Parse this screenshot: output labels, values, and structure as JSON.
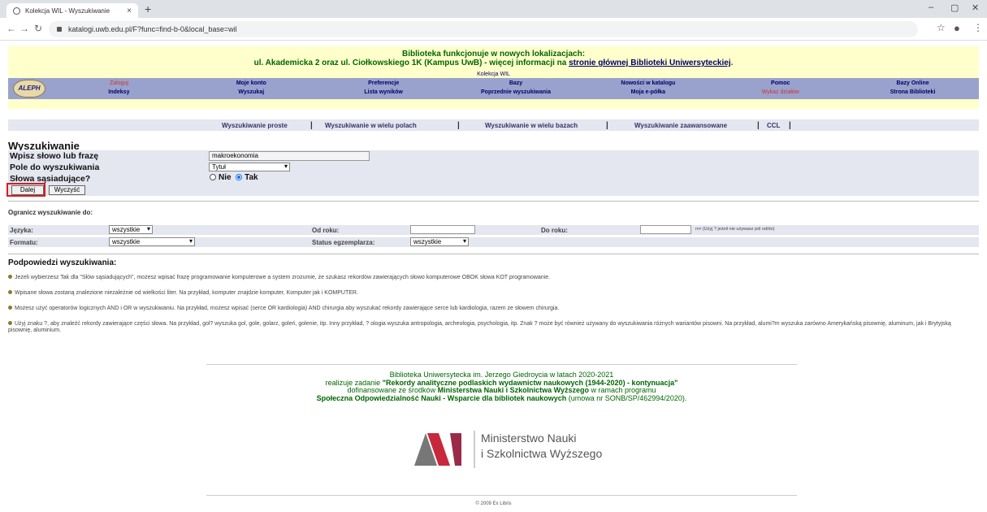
{
  "browser": {
    "tab_title": "Kolekcja WIL - Wyszukiwanie",
    "tab_close": "×",
    "new_tab": "+",
    "url": "katalogi.uwb.edu.pl/F?func=find-b-0&local_base=wil"
  },
  "banner": {
    "line1": "Biblioteka funkcjonuje w nowych lokalizacjach:",
    "line2_pre": "ul. Akademicka 2 oraz ul. Ciołkowskiego 1K (Kampus UwB) - więcej informacji na ",
    "line2_link": "stronie głównej Biblioteki Uniwersyteckiej",
    "line2_post": ".",
    "collection": "Kolekcja WIL"
  },
  "logo": "ALEPH",
  "menu": {
    "row1": [
      "Zaloguj",
      "Moje konto",
      "Preferencje",
      "Bazy",
      "Nowości w katalogu",
      "Pomoc",
      "Bazy Online"
    ],
    "row2": [
      "Indeksy",
      "Wyszukaj",
      "Lista wyników",
      "Poprzednie wyszukiwania",
      "Moja e-półka",
      "Wykaz działów",
      "Strona Biblioteki"
    ]
  },
  "search_tabs": [
    "Wyszukiwanie proste",
    "Wyszukiwanie w wielu polach",
    "Wyszukiwanie w wielu bazach",
    "Wyszukiwanie zaawansowane",
    "CCL"
  ],
  "search_tab_separator": "|",
  "form": {
    "heading": "Wyszukiwanie",
    "phrase_label": "Wpisz słowo lub frazę",
    "phrase_value": "makroekonomia",
    "field_label": "Pole do wyszukiwania",
    "field_value": "Tytuł",
    "adjacent_label": "Słowa sąsiadujące?",
    "adjacent_no": "Nie",
    "adjacent_yes": "Tak",
    "adjacent_selected": "Tak",
    "submit": "Dalej",
    "clear": "Wyczyść"
  },
  "limits": {
    "heading": "Ogranicz wyszukiwanie do:",
    "language_label": "Języka:",
    "language_value": "wszystkie",
    "from_year_label": "Od roku:",
    "to_year_label": "Do roku:",
    "year_note": "rrrr (Użyj ? jeżeli nie używasz pól od/do)",
    "format_label": "Formatu:",
    "format_value": "wszystkie",
    "status_label": "Status egzemplarza:",
    "status_value": "wszystkie"
  },
  "hints": {
    "heading": "Podpowiedzi wyszukiwania:",
    "h1": "Jeżeli wybierzesz Tak dla \"Słów sąsiadujących\", możesz wpisać frazę programowanie komputerowe a system zrozumie, że szukasz rekordów zawierających słowo komputerowe OBOK słowa KOT programowanie.",
    "h2": "Wpisane słowa zostaną znalezione niezależnie od wielkości liter. Na przykład, komputer znajdzie komputer, Komputer jak i KOMPUTER.",
    "h3": "Możesz użyć operatorów logicznych AND i OR w wyszukiwaniu. Na przykład, możesz wpisać (serce OR kardiologia) AND chirurgia aby wyszukać rekordy zawierające serce lub kardiologia, razem ze słowem chirurgia.",
    "h4": "Użyj znaku ?, aby znaleźć rekordy zawierające części słowa. Na przykład, gol? wyszuka gol, gole, golarz, goleń, golenie, itp. Inny przykład, ? ologia wyszuka antropologia, archeologia, psychologia, itp. Znak ? może być również używany do wyszukiwania różnych wariantów pisowni. Na przykład, alumi?m wyszuka zarówno Amerykańską pisownię, aluminum, jak i Brytyjską pisownię, aluminium."
  },
  "footer": {
    "l1": "Biblioteka Uniwersytecka im. Jerzego Giedroycia w latach 2020-2021",
    "l2_pre": "realizuje zadanie ",
    "l2_bold": "\"Rekordy analityczne podlaskich wydawnictw naukowych (1944-2020) - kontynuacja\"",
    "l3_pre": "dofinansowane ze środków ",
    "l3_bold": "Ministerstwa Nauki i Szkolnictwa Wyższego",
    "l3_post": " w ramach programu",
    "l4_bold": "Społeczna Odpowiedzialność Nauki - Wsparcie dla bibliotek naukowych",
    "l4_post": " (umowa nr SONB/SP/462994/2020).",
    "ministry_line1": "Ministerstwo Nauki",
    "ministry_line2": "i Szkolnictwa Wyższego",
    "copyright": "© 2009 Ex Libris"
  },
  "colors": {
    "menu_bg": "#99a2cc",
    "banner_bg": "#ffffcc",
    "form_bg": "#e4e6f0",
    "footer_text": "#006600",
    "highlight": "#d02020"
  }
}
